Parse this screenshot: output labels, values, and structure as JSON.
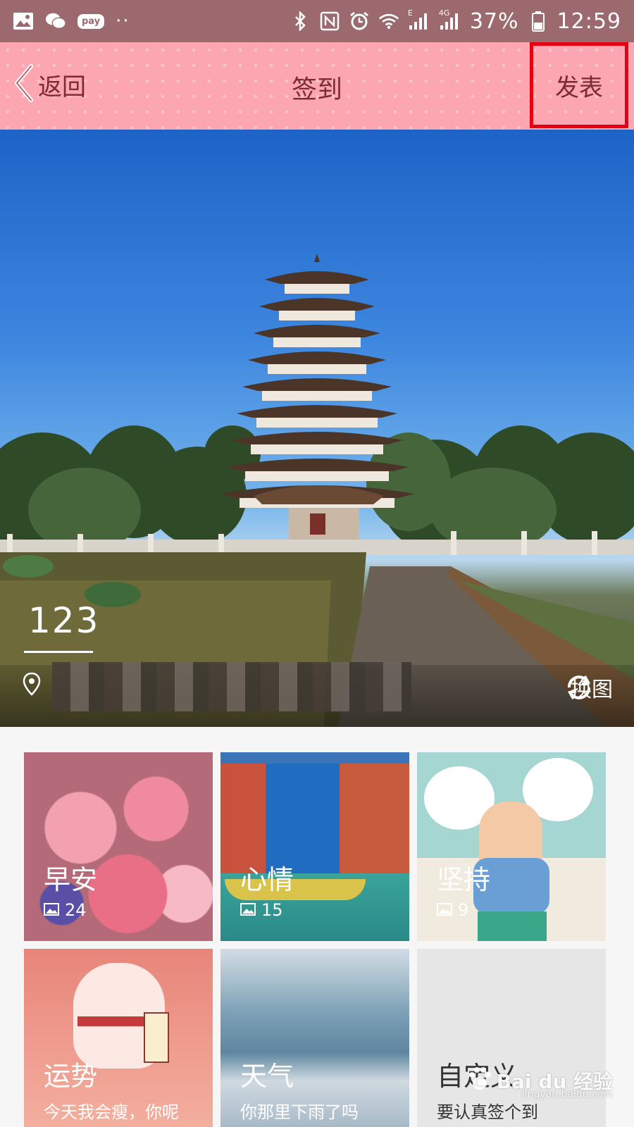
{
  "status_bar": {
    "battery": "37%",
    "time": "12:59",
    "pay_label": "pay",
    "dots": "··",
    "net_small_1": "E",
    "net_small_2": "4G",
    "icons": [
      "gallery-icon",
      "wechat-icon",
      "pay-icon",
      "bluetooth-icon",
      "nfc-icon",
      "alarm-icon",
      "wifi-icon",
      "signal-icon",
      "battery-icon"
    ]
  },
  "header": {
    "back_label": "返回",
    "title": "签到",
    "publish_label": "发表",
    "background_color": "#fba6b0",
    "text_color": "#7a2b34"
  },
  "hero": {
    "title": "123",
    "change_label": "换图"
  },
  "tiles": [
    {
      "title": "早安",
      "count": "24"
    },
    {
      "title": "心情",
      "count": "15"
    },
    {
      "title": "坚持",
      "count": "9"
    },
    {
      "title": "运势",
      "subtitle": "今天我会瘦，你呢"
    },
    {
      "title": "天气",
      "subtitle": "你那里下雨了吗"
    },
    {
      "title": "自定义",
      "subtitle": "要认真签个到"
    }
  ],
  "watermark": {
    "text": "Bai du 经验",
    "sub": "jingyan.baidu.com"
  },
  "highlight_color": "#e60012"
}
